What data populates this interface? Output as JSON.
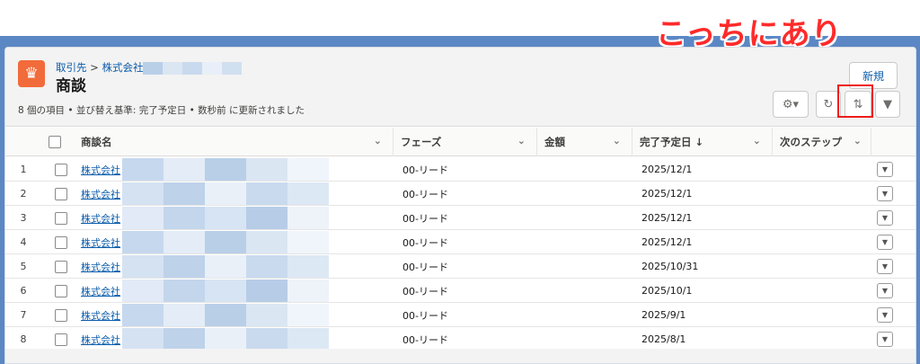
{
  "annotation": "こっちにあり",
  "header": {
    "breadcrumb_parent": "取引先",
    "breadcrumb_sep": ">",
    "breadcrumb_account": "株式会社",
    "title": "商談",
    "new_button": "新規",
    "info": "8 個の項目 • 並び替え基準: 完了予定日 • 数秒前 に更新されました"
  },
  "toolbar": {
    "settings_icon": "gear-icon",
    "refresh_icon": "refresh-icon",
    "sort_icon": "sort-arrows-icon",
    "filter_icon": "filter-icon"
  },
  "table": {
    "columns": [
      "商談名",
      "フェーズ",
      "金額",
      "完了予定日 ↓",
      "次のステップ"
    ],
    "rows": [
      {
        "num": "1",
        "name": "株式会社",
        "phase": "00-リード",
        "date": "2025/12/1"
      },
      {
        "num": "2",
        "name": "株式会社",
        "phase": "00-リード",
        "date": "2025/12/1"
      },
      {
        "num": "3",
        "name": "株式会社",
        "phase": "00-リード",
        "date": "2025/12/1"
      },
      {
        "num": "4",
        "name": "株式会社",
        "phase": "00-リード",
        "date": "2025/12/1"
      },
      {
        "num": "5",
        "name": "株式会社",
        "phase": "00-リード",
        "date": "2025/10/31"
      },
      {
        "num": "6",
        "name": "株式会社",
        "phase": "00-リード",
        "date": "2025/10/1"
      },
      {
        "num": "7",
        "name": "株式会社",
        "phase": "00-リード",
        "date": "2025/9/1"
      },
      {
        "num": "8",
        "name": "株式会社",
        "phase": "00-リード",
        "date": "2025/8/1"
      }
    ]
  },
  "colors": {
    "accent": "#0b5cab",
    "object_icon": "#f26b3a",
    "highlight": "#ee1c1c",
    "background": "#5b88c4"
  }
}
